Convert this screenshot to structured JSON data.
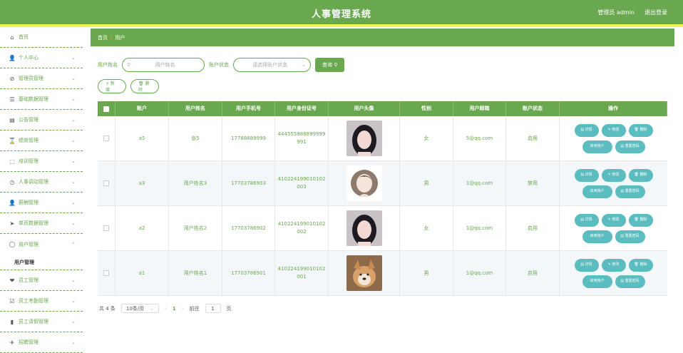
{
  "header": {
    "title": "人事管理系统",
    "user": "管理员 admin",
    "logout": "退出登录"
  },
  "sidebar": {
    "items": [
      {
        "label": "首页",
        "icon": "⌂"
      },
      {
        "label": "个人中心",
        "icon": "👤"
      },
      {
        "label": "管理员管理",
        "icon": "⊘"
      },
      {
        "label": "基础数据管理",
        "icon": "☰"
      },
      {
        "label": "公告管理",
        "icon": "▤"
      },
      {
        "label": "绩效管理",
        "icon": "⌛"
      },
      {
        "label": "培训管理",
        "icon": "⬚"
      },
      {
        "label": "人事调动管理",
        "icon": "◷"
      },
      {
        "label": "薪酬管理",
        "icon": "👤"
      },
      {
        "label": "单页数据管理",
        "icon": "➤"
      },
      {
        "label": "用户管理",
        "icon": "◯"
      },
      {
        "label": "员工管理",
        "icon": "❤"
      },
      {
        "label": "员工考勤管理",
        "icon": "☑"
      },
      {
        "label": "员工请假管理",
        "icon": "▮"
      },
      {
        "label": "招聘管理",
        "icon": "✈"
      }
    ],
    "submenu": {
      "label": "用户管理"
    }
  },
  "breadcrumb": {
    "home": "首页",
    "sep": "/",
    "current": "用户"
  },
  "search": {
    "name_label": "用户姓名",
    "name_placeholder": "用户姓名",
    "status_label": "账户状态",
    "status_placeholder": "请选择账户状态",
    "query_button": "查询 ⚲"
  },
  "actions": {
    "add": "+ 新增",
    "delete": "🗑 删除"
  },
  "table": {
    "columns": [
      "账户",
      "用户姓名",
      "用户手机号",
      "用户身份证号",
      "用户头像",
      "性别",
      "用户邮箱",
      "账户状态",
      "操作"
    ],
    "rows": [
      {
        "account": "a5",
        "name": "张5",
        "phone": "17788889999",
        "id_card": "444555888899999991",
        "gender": "女",
        "email": "5@qq.com",
        "status": "启用"
      },
      {
        "account": "a3",
        "name": "用户姓名3",
        "phone": "17703786903",
        "id_card": "410224199010102003",
        "gender": "男",
        "email": "1@qq.com",
        "status": "禁用"
      },
      {
        "account": "a2",
        "name": "用户姓名2",
        "phone": "17703786902",
        "id_card": "410224199010102002",
        "gender": "女",
        "email": "1@qq.com",
        "status": "启用"
      },
      {
        "account": "a1",
        "name": "用户姓名1",
        "phone": "17703786901",
        "id_card": "410224199010102001",
        "gender": "男",
        "email": "1@qq.com",
        "status": "启用"
      }
    ],
    "ops": {
      "detail": "▤ 详情",
      "edit": "✎ 修改",
      "delete": "🗑 删除",
      "toggle": "启用账户",
      "reset": "▤ 重置密码"
    }
  },
  "pager": {
    "total": "共 4 条",
    "size": "10条/页",
    "prev": "‹",
    "page": "1",
    "next": "›",
    "goto": "前往",
    "goto_value": "1",
    "page_unit": "页"
  },
  "colors": {
    "primary": "#6aa84f",
    "accent_line": "#f2f25a",
    "op_button": "#5bbdbf"
  }
}
